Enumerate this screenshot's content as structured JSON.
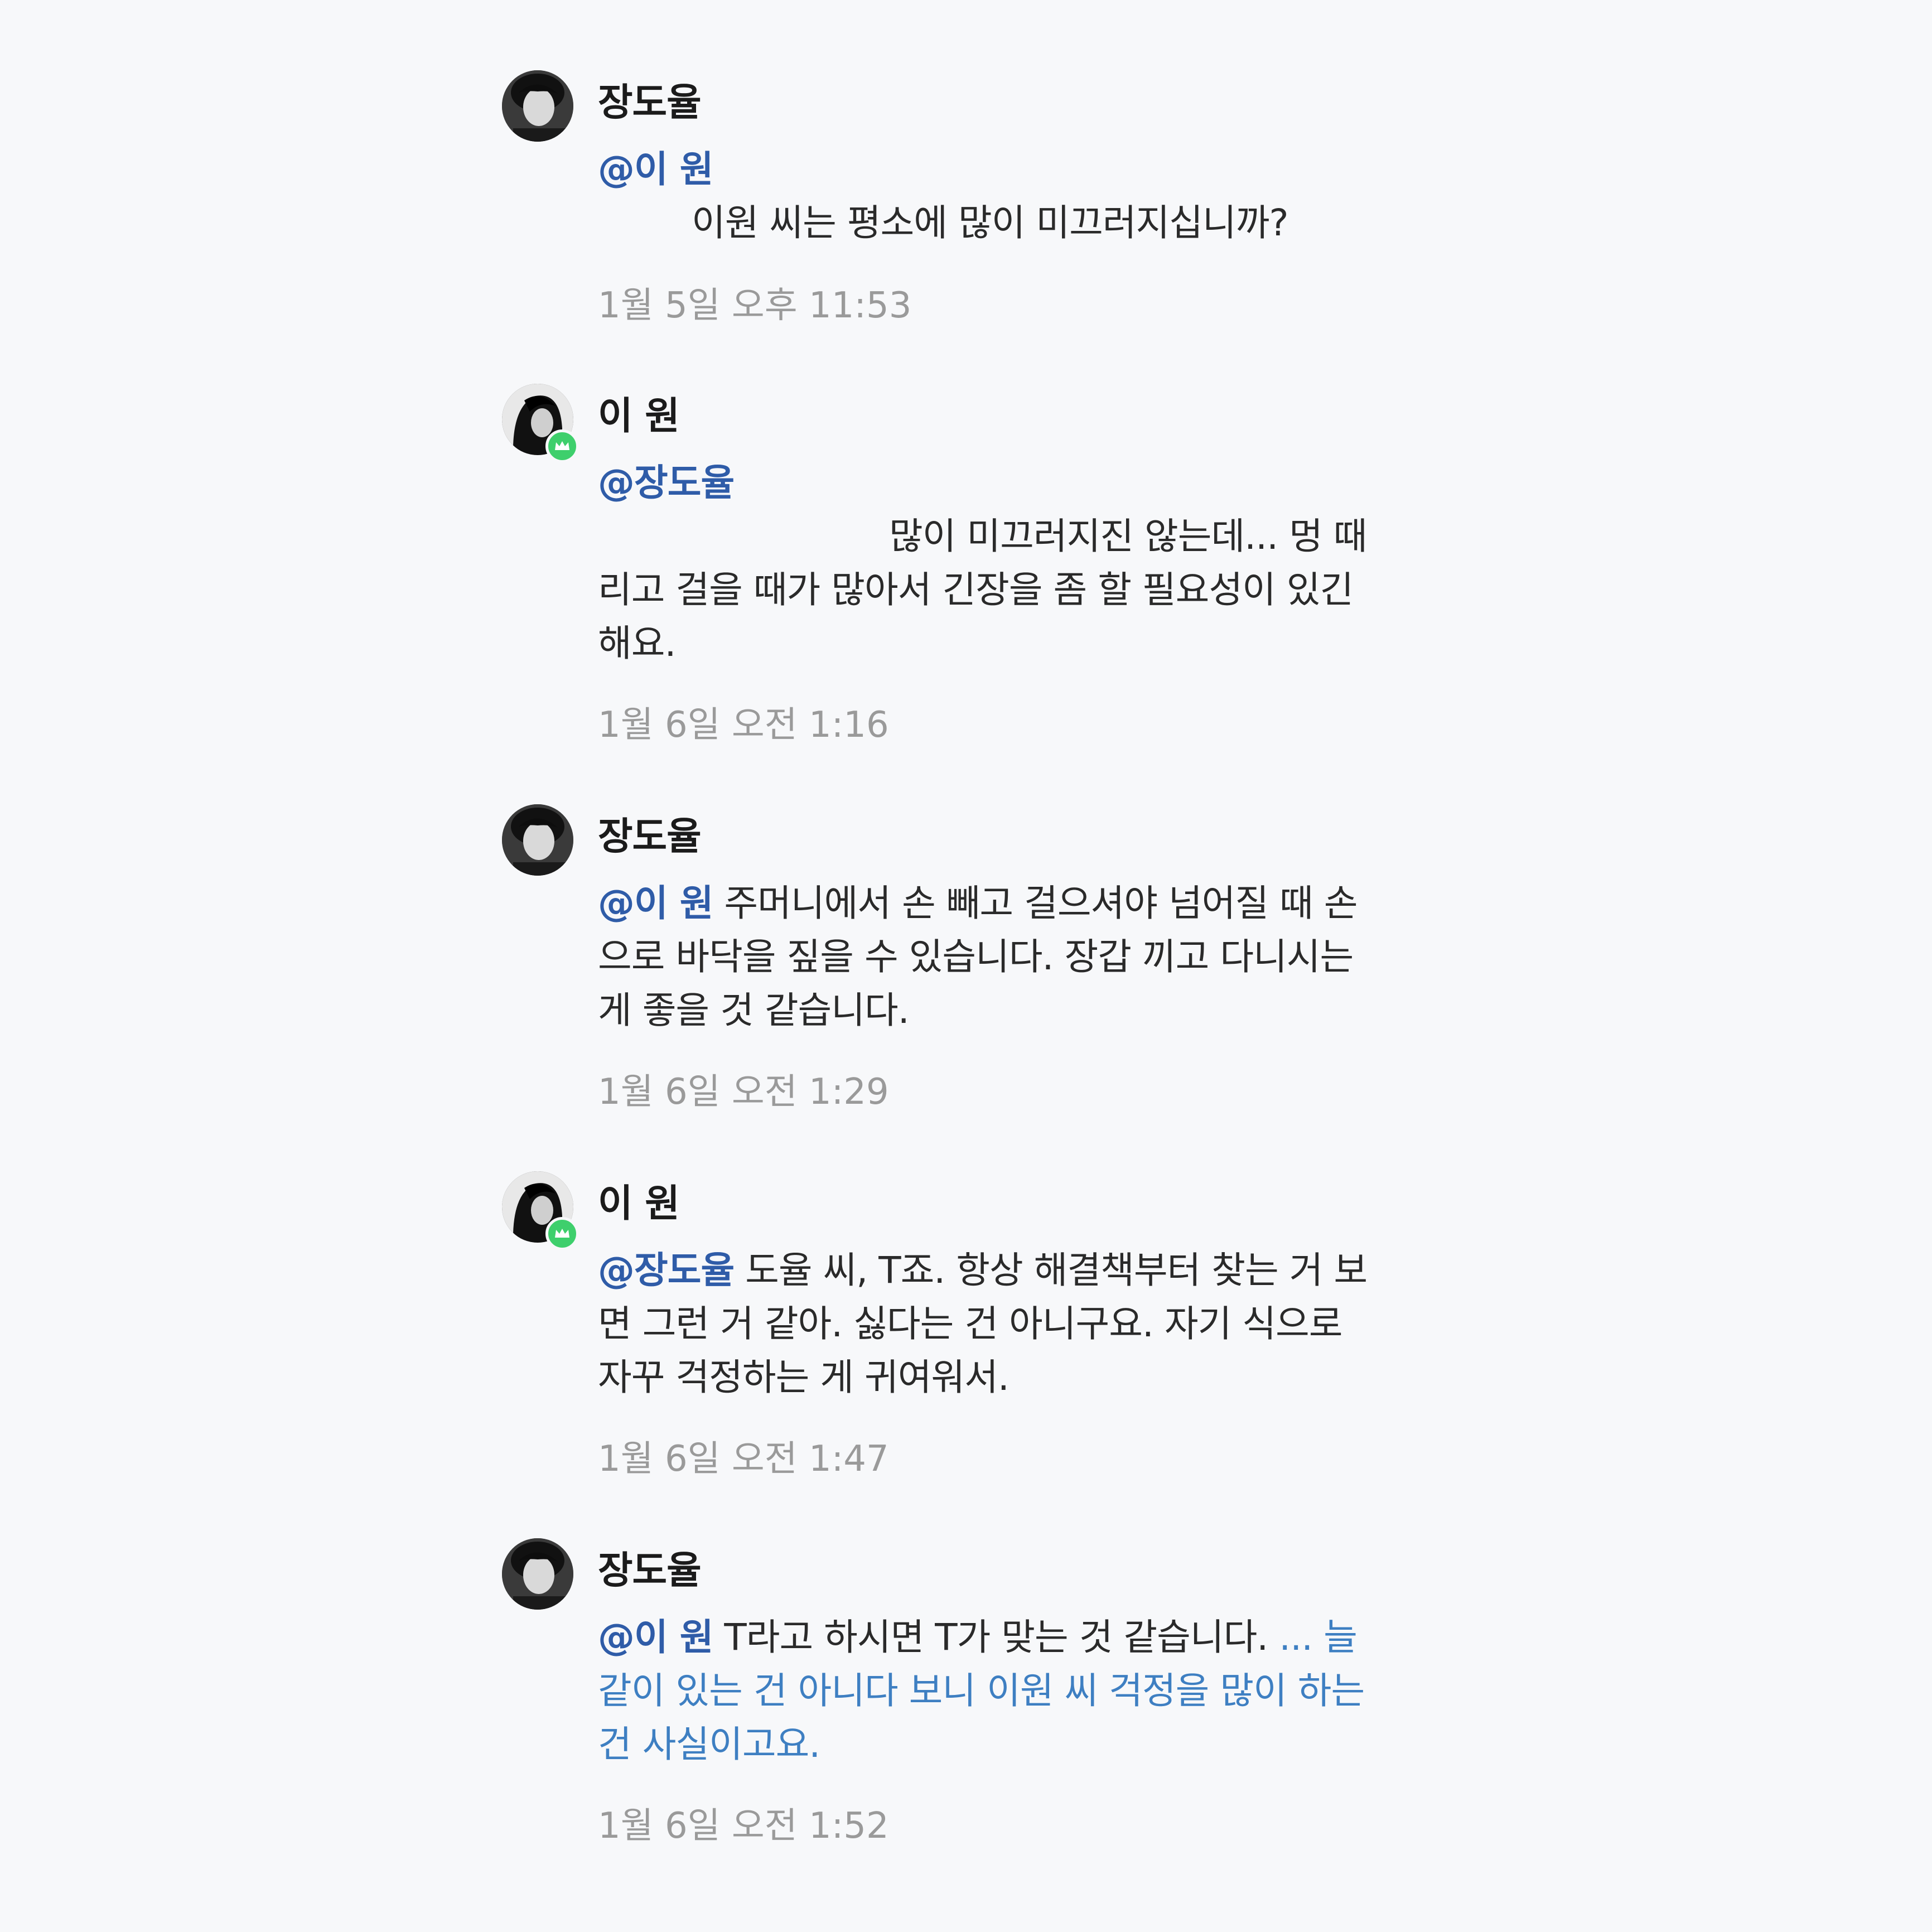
{
  "comments": [
    {
      "author": "장도율",
      "mention": "@이 원",
      "lines": [
        "이원 씨는 평소에 많이 미끄러지십니까?"
      ],
      "timestamp": "1월 5일 오후 11:53"
    },
    {
      "author": "이 원",
      "mention": "@장도율",
      "lines": [
        "많이 미끄러지진 않는데... 멍 때",
        "리고 걸을 때가 많아서 긴장을 좀 할 필요성이 있긴",
        "해요."
      ],
      "timestamp": "1월 6일 오전 1:16"
    },
    {
      "author": "장도율",
      "mention": "@이 원",
      "lines": [
        "주머니에서 손 빼고 걸으셔야 넘어질 때 손",
        "으로 바닥을 짚을 수 있습니다. 장갑 끼고 다니시는",
        "게 좋을 것 같습니다."
      ],
      "timestamp": "1월 6일 오전 1:29"
    },
    {
      "author": "이 원",
      "mention": "@장도율",
      "lines": [
        "도율 씨, T죠. 항상 해결책부터 찾는 거 보",
        "면 그런 거 같아. 싫다는 건 아니구요. 자기 식으로",
        "자꾸 걱정하는 게 귀여워서."
      ],
      "timestamp": "1월 6일 오전 1:47"
    },
    {
      "author": "장도율",
      "mention": "@이 원",
      "lines": [
        "T라고 하시면 T가 맞는 것 같습니다. "
      ],
      "link_lines": [
        "... 늘",
        "같이 있는 건 아니다 보니 이원 씨 걱정을 많이 하는",
        "건 사실이고요."
      ],
      "timestamp": "1월 6일 오전 1:52"
    }
  ],
  "colors": {
    "background": "#f7f8fa",
    "mention": "#2f5ca8",
    "link": "#3e7fc2",
    "timestamp": "#9a9a9a",
    "badge": "#3ecf6c"
  },
  "icons": [
    "avatar-jang",
    "avatar-lee",
    "crown-icon"
  ]
}
